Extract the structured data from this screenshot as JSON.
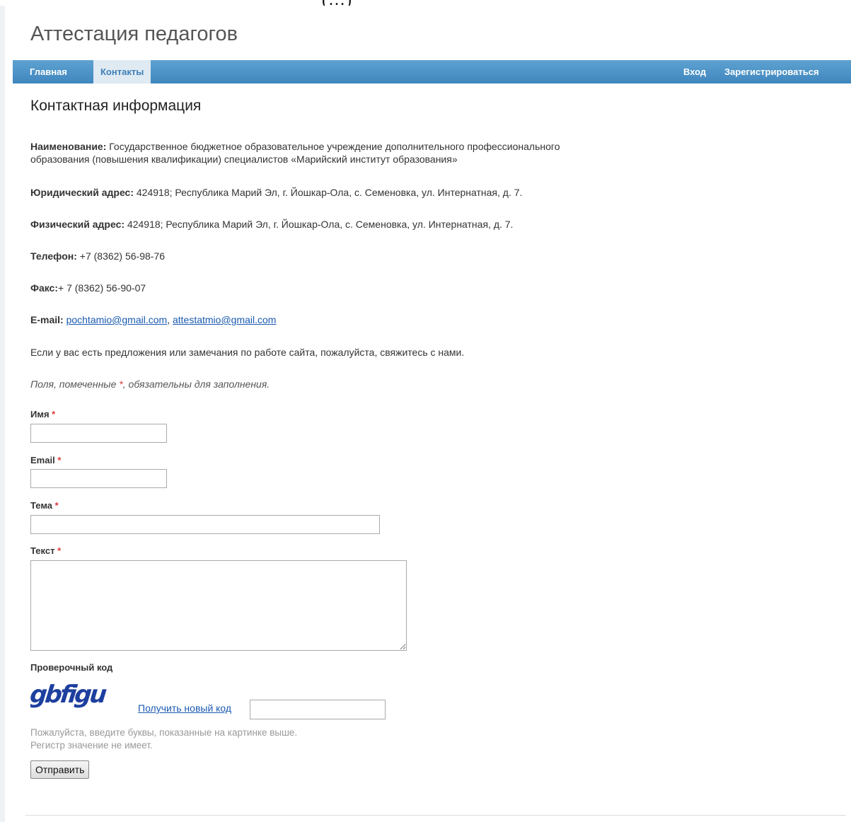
{
  "top_fragment": "(…)",
  "header": {
    "title": "Аттестация педагогов"
  },
  "nav": {
    "items": [
      {
        "label": "Главная"
      },
      {
        "label": "Контакты"
      }
    ],
    "login": "Вход",
    "register": "Зарегистрироваться"
  },
  "page_title": "Контактная информация",
  "info": {
    "name_label": "Наименование:",
    "name_line1": "Государственное бюджетное образовательное учреждение дополнительного профессионального",
    "name_line2": "образования (повышения квалификации) специалистов «Марийский институт образования»",
    "legal_label": "Юридический адрес:",
    "legal_value": "424918; Республика Марий Эл, г. Йошкар-Ола, с. Семеновка, ул. Интернатная, д. 7.",
    "physical_label": "Физический адрес:",
    "physical_value": "424918; Республика Марий Эл, г. Йошкар-Ола, с. Семеновка, ул. Интернатная, д. 7.",
    "phone_label": "Телефон:",
    "phone_value": "+7 (8362) 56-98-76",
    "fax_label": "Факс:",
    "fax_value": "+ 7 (8362) 56-90-07",
    "email_label": "E-mail:",
    "email_1": "pochtamio@gmail.com",
    "email_sep": ", ",
    "email_2": "attestatmio@gmail.com"
  },
  "feedback_text": "Если у вас есть предложения или замечания по работе сайта, пожалуйста, свяжитесь с нами.",
  "required_note": {
    "before": "Поля, помеченные ",
    "star": "*",
    "after": ", обязательны для заполнения."
  },
  "form": {
    "name_label": "Имя",
    "name_value": "",
    "email_label": "Email",
    "email_value": "",
    "subject_label": "Тема",
    "subject_value": "",
    "text_label": "Текст",
    "text_value": "",
    "required_star": "*",
    "captcha_label": "Проверочный код",
    "captcha_text": "gbfigu",
    "captcha_refresh": "Получить новый код",
    "captcha_value": "",
    "captcha_hint_1": "Пожалуйста, введите буквы, показанные на картинке выше.",
    "captcha_hint_2": "Регистр значение не имеет.",
    "submit": "Отправить"
  },
  "colors": {
    "nav_top": "#5ea2d1",
    "nav_bottom": "#3f86be",
    "link": "#1a5ab0",
    "required": "#e03a3a",
    "captcha": "#1d3f9e"
  }
}
